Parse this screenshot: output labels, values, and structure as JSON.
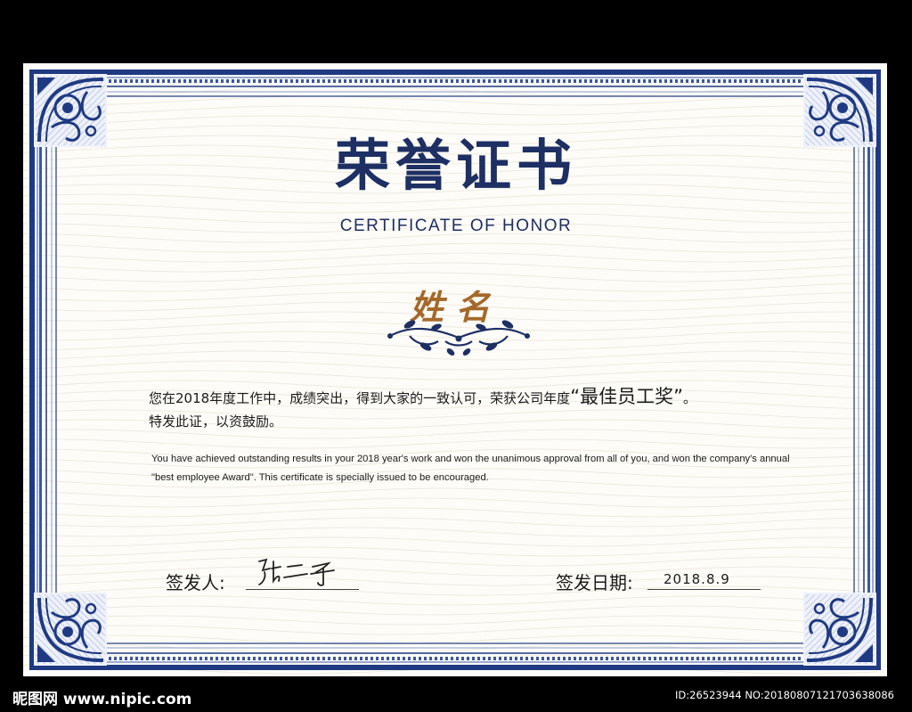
{
  "certificate": {
    "title_cn": "荣誉证书",
    "title_en": "CERTIFICATE OF HONOR",
    "name": "姓名",
    "body_cn_part1": "您在2018年度工作中，成绩突出，得到大家的一致认可，荣获公司年度",
    "award_text": "“最佳员工奖”",
    "body_cn_period": "。",
    "body_cn_line2": "特发此证，以资鼓励。",
    "body_en": "You have achieved outstanding results in your 2018 year's work and won the unanimous approval from all of you, and won the company's annual \"best employee Award\". This certificate is specially issued to be encouraged.",
    "issuer_label": "签发人:",
    "issuer_signature": "张二千",
    "date_label": "签发日期:",
    "date_value": "2018.8.9"
  },
  "watermark": {
    "site": "昵图网 www.nipic.com",
    "id_text": "ID:26523944 NO:20180807121703638086"
  },
  "colors": {
    "frame_blue": "#1f3a82",
    "title_navy": "#1d2f63",
    "name_gold": "#a4692a",
    "paper": "#fdfcf8",
    "background": "#000000"
  },
  "icons": {
    "corner_ornament": "scroll-ornament-icon",
    "name_flourish": "vine-flourish-icon"
  }
}
